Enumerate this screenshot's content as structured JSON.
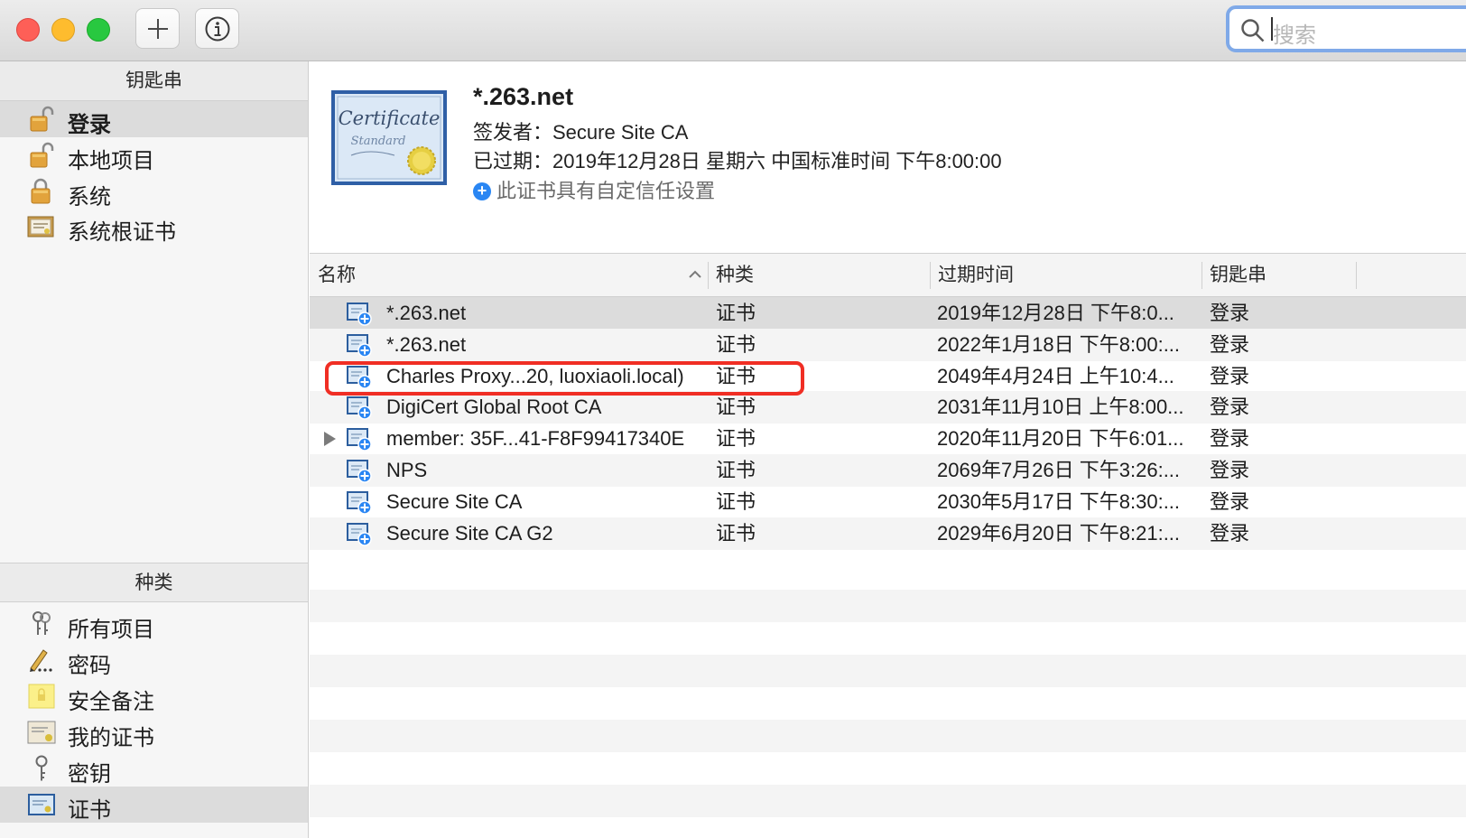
{
  "toolbar": {
    "search_placeholder": "搜索",
    "add_button": "+",
    "info_button": "i"
  },
  "sidebar": {
    "keychains_header": "钥匙串",
    "keychains": [
      {
        "label": "登录",
        "icon": "lock-open-icon",
        "selected": true
      },
      {
        "label": "本地项目",
        "icon": "lock-open-icon",
        "selected": false
      },
      {
        "label": "系统",
        "icon": "lock-closed-icon",
        "selected": false
      },
      {
        "label": "系统根证书",
        "icon": "certificate-cabinet-icon",
        "selected": false
      }
    ],
    "category_header": "种类",
    "categories": [
      {
        "label": "所有项目",
        "icon": "keys-icon",
        "selected": false
      },
      {
        "label": "密码",
        "icon": "pencil-dots-icon",
        "selected": false
      },
      {
        "label": "安全备注",
        "icon": "note-icon",
        "selected": false
      },
      {
        "label": "我的证书",
        "icon": "certificate-icon",
        "selected": false
      },
      {
        "label": "密钥",
        "icon": "key-icon",
        "selected": false
      },
      {
        "label": "证书",
        "icon": "certificate-icon",
        "selected": true
      }
    ]
  },
  "detail": {
    "title": "*.263.net",
    "issuer": "签发者：Secure Site CA",
    "expired": "已过期：2019年12月28日 星期六 中国标准时间 下午8:00:00",
    "trust": "此证书具有自定信任设置"
  },
  "table": {
    "columns": [
      "名称",
      "种类",
      "过期时间",
      "钥匙串"
    ],
    "rows": [
      {
        "name": "*.263.net",
        "kind": "证书",
        "expires": "2019年12月28日 下午8:0...",
        "keychain": "登录",
        "selected": true,
        "expandable": false
      },
      {
        "name": "*.263.net",
        "kind": "证书",
        "expires": "2022年1月18日 下午8:00:...",
        "keychain": "登录",
        "selected": false,
        "expandable": false
      },
      {
        "name": "Charles Proxy...20, luoxiaoli.local)",
        "kind": "证书",
        "expires": "2049年4月24日 上午10:4...",
        "keychain": "登录",
        "selected": false,
        "expandable": false,
        "highlighted": true
      },
      {
        "name": "DigiCert Global Root CA",
        "kind": "证书",
        "expires": "2031年11月10日 上午8:00...",
        "keychain": "登录",
        "selected": false,
        "expandable": false
      },
      {
        "name": "member: 35F...41-F8F99417340E",
        "kind": "证书",
        "expires": "2020年11月20日 下午6:01...",
        "keychain": "登录",
        "selected": false,
        "expandable": true
      },
      {
        "name": "NPS",
        "kind": "证书",
        "expires": "2069年7月26日 下午3:26:...",
        "keychain": "登录",
        "selected": false,
        "expandable": false
      },
      {
        "name": "Secure Site CA",
        "kind": "证书",
        "expires": "2030年5月17日 下午8:30:...",
        "keychain": "登录",
        "selected": false,
        "expandable": false
      },
      {
        "name": "Secure Site CA G2",
        "kind": "证书",
        "expires": "2029年6月20日 下午8:21:...",
        "keychain": "登录",
        "selected": false,
        "expandable": false
      }
    ]
  },
  "colors": {
    "selection_gray": "#dcdcdc",
    "highlight_red": "#f02e24",
    "search_focus_blue": "#7fa9e8",
    "trust_plus_blue": "#2a86f3"
  }
}
